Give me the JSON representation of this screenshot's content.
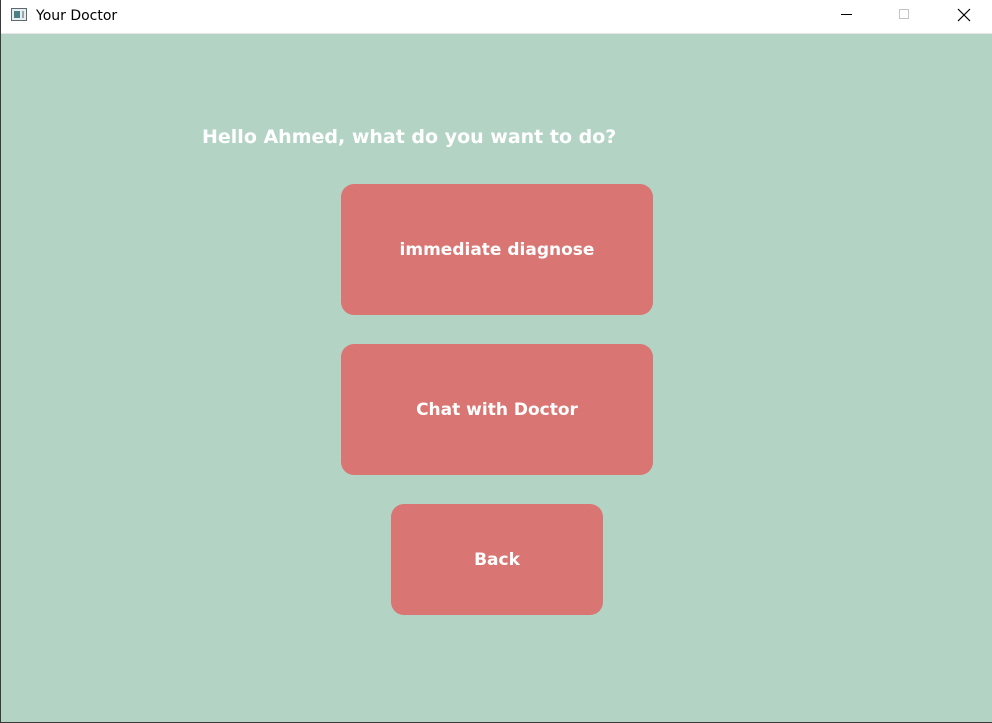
{
  "window": {
    "title": "Your Doctor"
  },
  "main": {
    "greeting": "Hello Ahmed, what do you want to do?",
    "buttons": {
      "diagnose_label": "immediate diagnose",
      "chat_label": "Chat with Doctor",
      "back_label": "Back"
    }
  },
  "colors": {
    "background": "#b3d4c5",
    "button": "#d97673",
    "text": "#ffffff"
  },
  "icons": {
    "app": "app-window-icon",
    "minimize": "minimize-icon",
    "maximize": "maximize-icon",
    "close": "close-icon"
  }
}
